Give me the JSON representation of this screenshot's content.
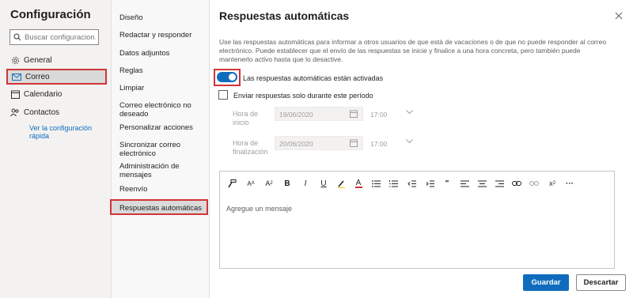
{
  "left": {
    "title": "Configuración",
    "search_placeholder": "Buscar configuracion...",
    "items": [
      {
        "label": "General",
        "icon": "gear-icon"
      },
      {
        "label": "Correo",
        "icon": "mail-icon"
      },
      {
        "label": "Calendario",
        "icon": "calendar-icon"
      },
      {
        "label": "Contactos",
        "icon": "people-icon"
      }
    ],
    "quick_settings_link": "Ver la configuración rápida"
  },
  "mid": {
    "items": [
      "Diseño",
      "Redactar y responder",
      "Datos adjuntos",
      "Reglas",
      "Limpiar",
      "Correo electrónico no deseado",
      "Personalizar acciones",
      "Sincronizar correo electrónico",
      "Administración de mensajes",
      "Reenvío",
      "Respuestas automáticas"
    ]
  },
  "main": {
    "title": "Respuestas automáticas",
    "description": "Use las respuestas automáticas para informar a otros usuarios de que está de vacaciones o de que no puede responder al correo electrónico. Puede establecer que el envío de las respuestas se inicie y finalice a una hora concreta, pero también puede mantenerlo activo hasta que lo desactive.",
    "toggle_label": "Las respuestas automáticas están activadas",
    "toggle_on": true,
    "period_checkbox_label": "Enviar respuestas solo durante este período",
    "start_label": "Hora de inicio",
    "start_date": "19/06/2020",
    "start_time": "17:00",
    "end_label": "Hora de finalización",
    "end_date": "20/06/2020",
    "end_time": "17:00",
    "editor_placeholder": "Agregue un mensaje",
    "save_label": "Guardar",
    "cancel_label": "Descartar"
  },
  "colors": {
    "accent": "#0f6cbd",
    "highlight_border": "#d13438"
  }
}
